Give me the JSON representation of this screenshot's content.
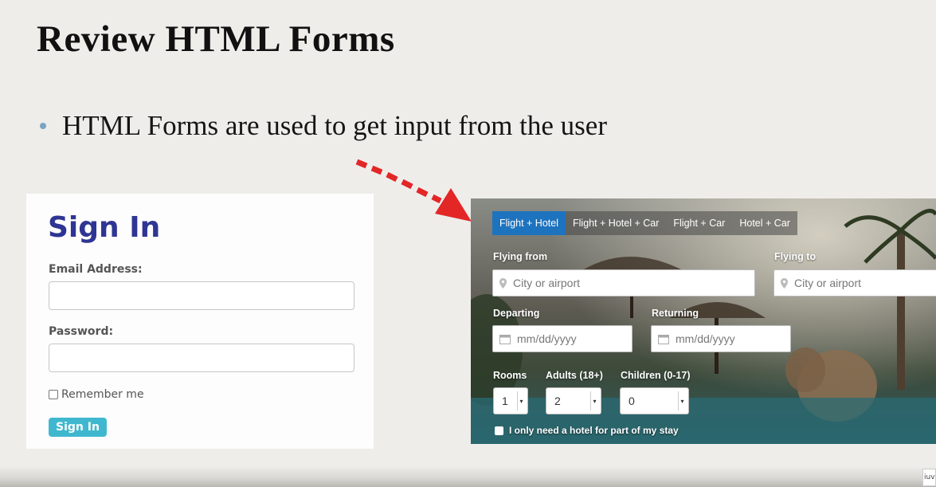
{
  "slide": {
    "title": "Review HTML Forms",
    "bullet": "HTML Forms are used to get input from the user"
  },
  "signin_form": {
    "title": "Sign In",
    "email_label": "Email Address:",
    "password_label": "Password:",
    "remember_label": "Remember me",
    "button_label": "Sign In"
  },
  "travel_form": {
    "tabs": [
      {
        "label": "Flight + Hotel",
        "active": true
      },
      {
        "label": "Flight + Hotel + Car",
        "active": false
      },
      {
        "label": "Flight + Car",
        "active": false
      },
      {
        "label": "Hotel + Car",
        "active": false
      }
    ],
    "flying_from_label": "Flying from",
    "flying_from_placeholder": "City or airport",
    "flying_to_label": "Flying to",
    "flying_to_placeholder": "City or airport",
    "departing_label": "Departing",
    "departing_placeholder": "mm/dd/yyyy",
    "returning_label": "Returning",
    "returning_placeholder": "mm/dd/yyyy",
    "rooms_label": "Rooms",
    "rooms_value": "1",
    "adults_label": "Adults (18+)",
    "adults_value": "2",
    "children_label": "Children (0-17)",
    "children_value": "0",
    "partial_stay_label": "I only need a hotel for part of my stay",
    "active_tab_color": "#1e73be"
  },
  "colors": {
    "signin_title": "#2f3592",
    "signin_button": "#3fb8cf",
    "arrow": "#e32626",
    "bullet": "#7aa4c4"
  },
  "corner_badge": "iuv"
}
